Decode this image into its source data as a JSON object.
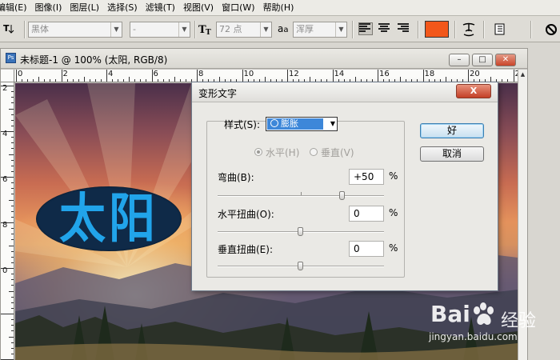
{
  "menu": [
    "编辑(E)",
    "图像(I)",
    "图层(L)",
    "选择(S)",
    "滤镜(T)",
    "视图(V)",
    "窗口(W)",
    "帮助(H)"
  ],
  "options": {
    "font_family": "黑体",
    "font_style": "-",
    "font_size": "72 点",
    "aa_icon_text": "a",
    "aa_icon_sub": "a",
    "anti_alias": "浑厚",
    "text_color": "#f2571a"
  },
  "document": {
    "title": "未标题-1 @ 100% (太阳, RGB/8)",
    "ruler_h": [
      "0",
      "2",
      "4",
      "6",
      "8",
      "10",
      "12",
      "14",
      "16",
      "18",
      "20",
      "2"
    ],
    "ruler_v": [
      "2",
      "4",
      "6",
      "8",
      "0"
    ],
    "warped_text": "太阳",
    "warp_fill": "#0f2a48",
    "text_fill": "#21a4ea"
  },
  "dialog": {
    "title": "变形文字",
    "close_label": "X",
    "style_label": "样式(S):",
    "style_value": "膨胀",
    "horizontal_label": "水平(H)",
    "vertical_label": "垂直(V)",
    "bend_label": "弯曲(B):",
    "bend_value": "+50",
    "hdistort_label": "水平扭曲(O):",
    "hdistort_value": "0",
    "vdistort_label": "垂直扭曲(E):",
    "vdistort_value": "0",
    "percent": "%",
    "ok_label": "好",
    "cancel_label": "取消",
    "bend_slider_level": 75,
    "hdistort_slider_level": 50,
    "vdistort_slider_level": 50
  },
  "watermark": {
    "brand": "Bai",
    "brand_cn": "经验",
    "url": "jingyan.baidu.com"
  }
}
